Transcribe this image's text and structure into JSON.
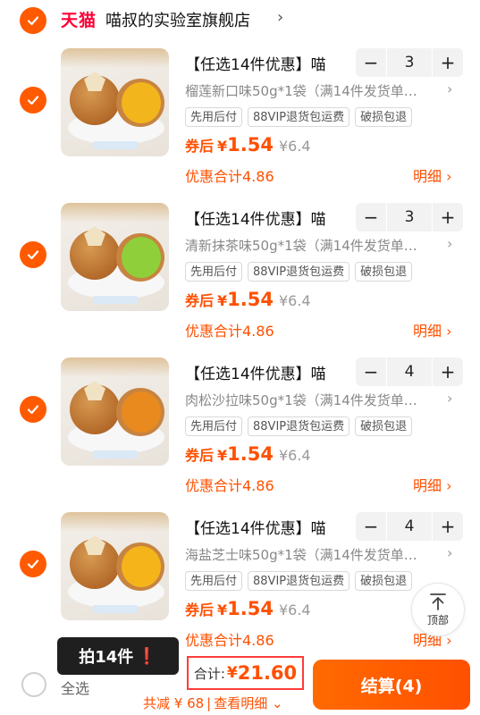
{
  "shop": {
    "platform_logo": "天猫",
    "name": "喵叔的实验室旗舰店",
    "arrow": "›"
  },
  "colors": {
    "accent": "#ff5000",
    "check": "#ff5a00",
    "tmall": "#ff0036"
  },
  "items": [
    {
      "title": "【任选14件优惠】喵",
      "spec": "榴莲新口味50g*1袋（满14件发货单…",
      "quantity": "3",
      "tags": [
        "先用后付",
        "88VIP退货包运费",
        "破损包退"
      ],
      "price_prefix": "券后",
      "currency": "¥",
      "price": "1.54",
      "original_price": "¥6.4",
      "discount": "优惠合计4.86",
      "detail": "明细 ›",
      "fill_color": "#f2b51c"
    },
    {
      "title": "【任选14件优惠】喵",
      "spec": "清新抹茶味50g*1袋（满14件发货单…",
      "quantity": "3",
      "tags": [
        "先用后付",
        "88VIP退货包运费",
        "破损包退"
      ],
      "price_prefix": "券后",
      "currency": "¥",
      "price": "1.54",
      "original_price": "¥6.4",
      "discount": "优惠合计4.86",
      "detail": "明细 ›",
      "fill_color": "#8fcf3a"
    },
    {
      "title": "【任选14件优惠】喵",
      "spec": "肉松沙拉味50g*1袋（满14件发货单…",
      "quantity": "4",
      "tags": [
        "先用后付",
        "88VIP退货包运费",
        "破损包退"
      ],
      "price_prefix": "券后",
      "currency": "¥",
      "price": "1.54",
      "original_price": "¥6.4",
      "discount": "优惠合计4.86",
      "detail": "明细 ›",
      "fill_color": "#e98a1f"
    },
    {
      "title": "【任选14件优惠】喵",
      "spec": "海盐芝士味50g*1袋（满14件发货单…",
      "quantity": "4",
      "tags": [
        "先用后付",
        "88VIP退货包运费",
        "破损包退"
      ],
      "price_prefix": "券后",
      "currency": "¥",
      "price": "1.54",
      "original_price": "¥6.4",
      "discount": "优惠合计4.86",
      "detail": "明细 ›",
      "fill_color": "#f5b51a"
    }
  ],
  "stepper": {
    "minus": "−",
    "plus": "+"
  },
  "back_to_top": {
    "label": "顶部",
    "icon": "arrow-up-icon"
  },
  "tooltip": {
    "text": "拍14件",
    "mark": "❗"
  },
  "bottom": {
    "select_all": "全选",
    "total_label": "合计:",
    "total_currency": "¥",
    "total_value": "21.60",
    "saving": "共减 ¥ 68",
    "separator": "|",
    "view_detail": "查看明细 ⌄",
    "checkout": "结算(4)"
  }
}
